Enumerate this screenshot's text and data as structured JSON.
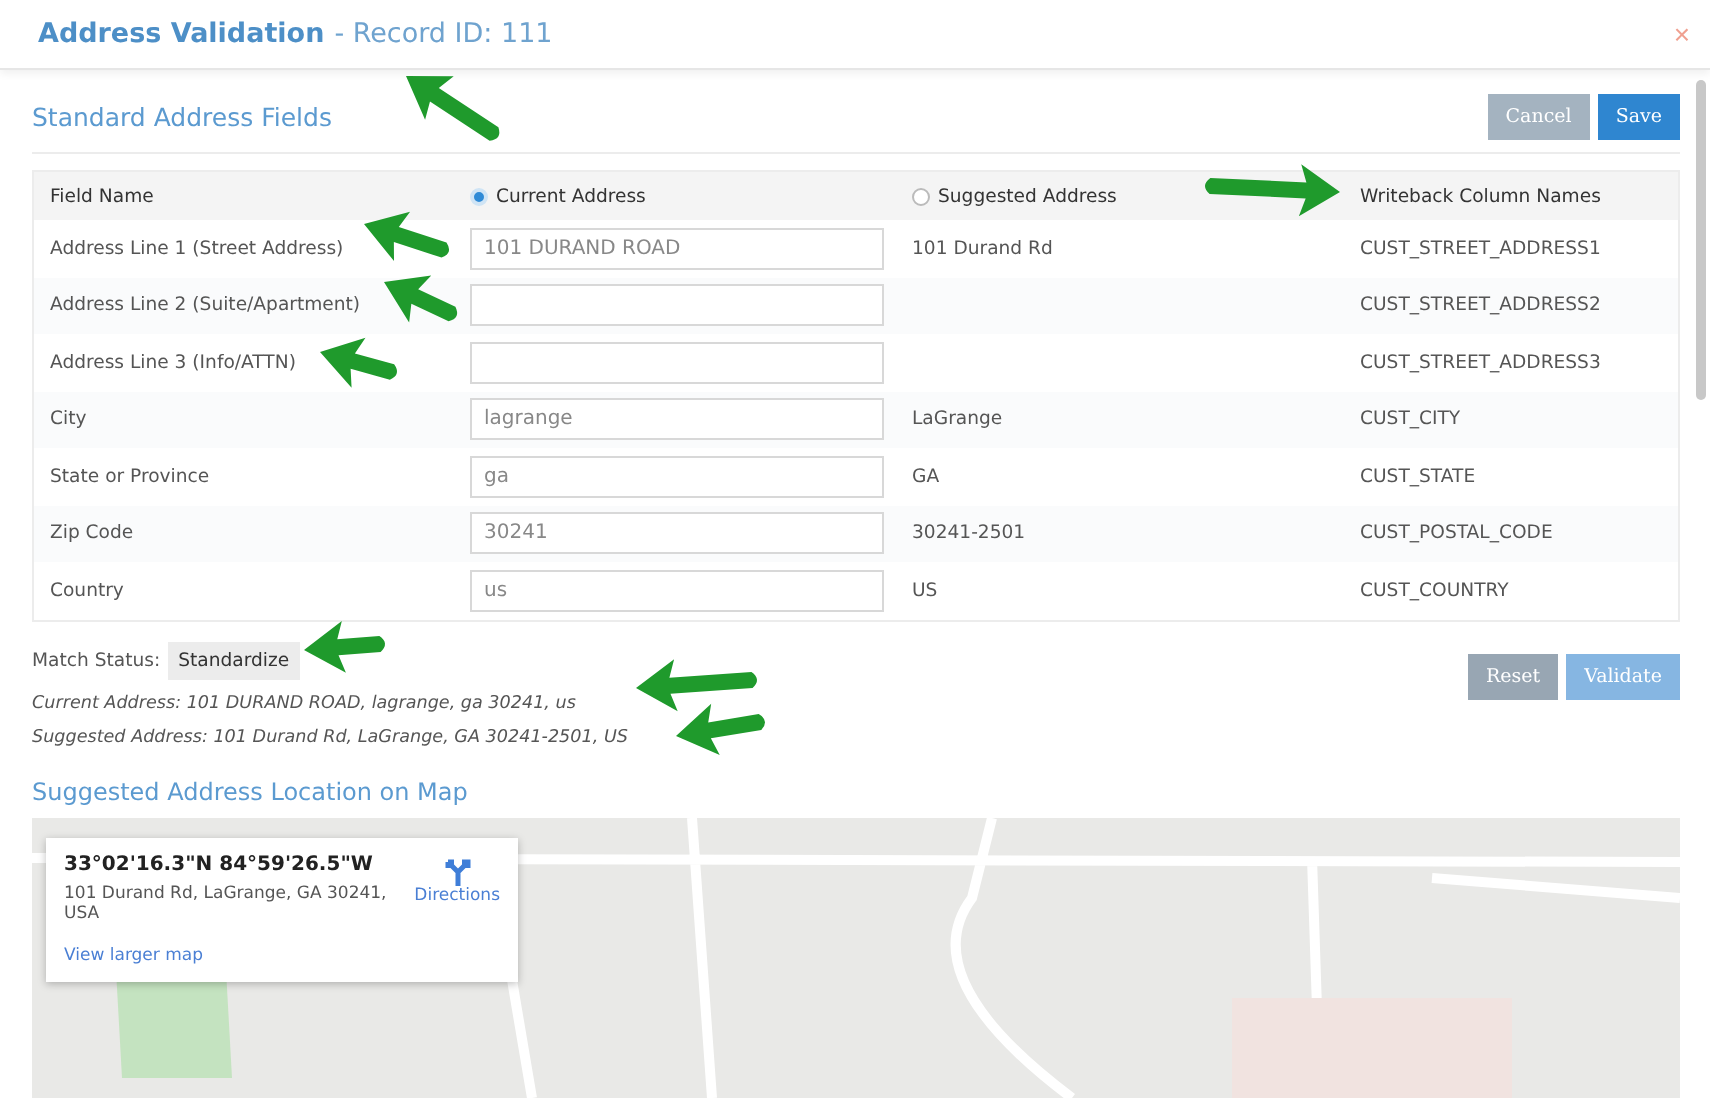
{
  "window": {
    "title": "Address Validation",
    "subtitle": "- Record ID: 111",
    "close": "×"
  },
  "section_title": "Standard Address Fields",
  "top_buttons": [
    {
      "label": "Cancel",
      "kind": "secondary"
    },
    {
      "label": "Save",
      "kind": "primary"
    }
  ],
  "table": {
    "columns": [
      {
        "label": "Field Name",
        "kind": "text"
      },
      {
        "label": "Current Address",
        "kind": "radio",
        "selected": true
      },
      {
        "label": "Suggested Address",
        "kind": "radio",
        "selected": false
      },
      {
        "label": "Writeback Column Names",
        "kind": "text"
      }
    ],
    "rows": [
      {
        "field": "Address Line 1 (Street Address)",
        "current": "101 DURAND ROAD",
        "suggested": "101 Durand Rd",
        "writeback": "CUST_STREET_ADDRESS1"
      },
      {
        "field": "Address Line 2 (Suite/Apartment)",
        "current": "",
        "suggested": "",
        "writeback": "CUST_STREET_ADDRESS2"
      },
      {
        "field": "Address Line 3 (Info/ATTN)",
        "current": "",
        "suggested": "",
        "writeback": "CUST_STREET_ADDRESS3"
      },
      {
        "field": "City",
        "current": "lagrange",
        "suggested": "LaGrange",
        "writeback": "CUST_CITY"
      },
      {
        "field": "State or Province",
        "current": "ga",
        "suggested": "GA",
        "writeback": "CUST_STATE"
      },
      {
        "field": "Zip Code",
        "current": "30241",
        "suggested": "30241-2501",
        "writeback": "CUST_POSTAL_CODE"
      },
      {
        "field": "Country",
        "current": "us",
        "suggested": "US",
        "writeback": "CUST_COUNTRY"
      }
    ]
  },
  "match_status": {
    "label": "Match Status:",
    "value": "Standardize"
  },
  "summary": [
    "Current Address: 101 DURAND ROAD, lagrange, ga 30241, us",
    "Suggested Address: 101 Durand Rd, LaGrange, GA 30241-2501, US"
  ],
  "bottom_buttons": [
    {
      "label": "Reset",
      "kind": "secondary"
    },
    {
      "label": "Validate",
      "kind": "primary"
    }
  ],
  "map_title": "Suggested Address Location on Map",
  "map_card": {
    "coordinates": "33°02'16.3\"N 84°59'26.5\"W",
    "address": "101 Durand Rd, LaGrange, GA 30241, USA",
    "directions": "Directions",
    "link": "View larger map"
  }
}
